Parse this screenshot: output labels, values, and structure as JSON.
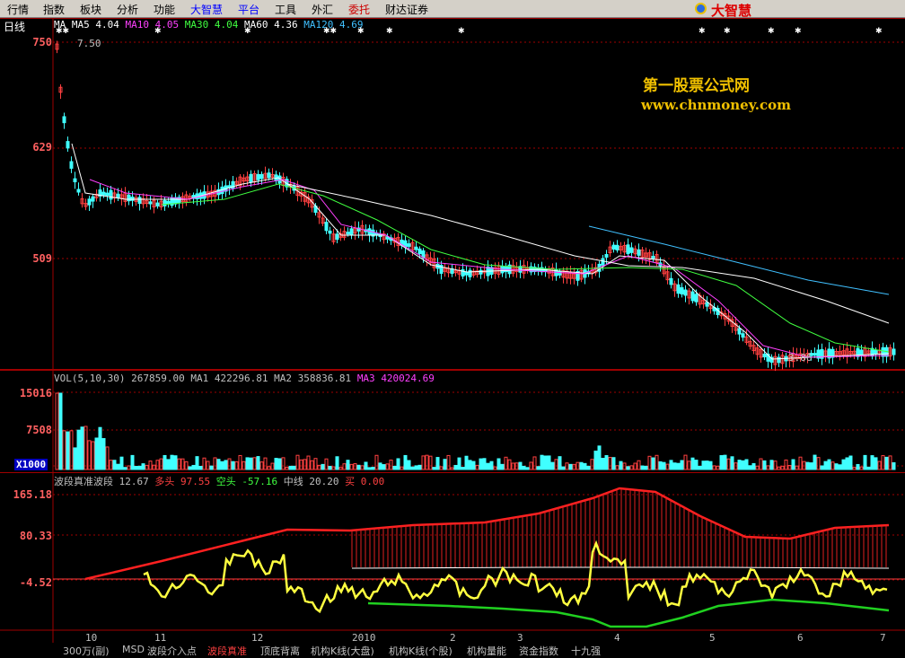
{
  "menu": {
    "items": [
      {
        "label": "行情",
        "style": "normal"
      },
      {
        "label": "指数",
        "style": "normal"
      },
      {
        "label": "板块",
        "style": "normal"
      },
      {
        "label": "分析",
        "style": "normal"
      },
      {
        "label": "功能",
        "style": "normal"
      },
      {
        "label": "大智慧",
        "style": "brand"
      },
      {
        "label": "平台",
        "style": "brand"
      },
      {
        "label": "工具",
        "style": "normal"
      },
      {
        "label": "外汇",
        "style": "normal"
      },
      {
        "label": "委托",
        "style": "red"
      },
      {
        "label": "财达证券",
        "style": "normal"
      }
    ],
    "logo": "大智慧",
    "logo_icon": "globe-icon"
  },
  "main_chart": {
    "period": "日线",
    "legend": [
      {
        "label": "MA",
        "value": "",
        "color": "#ffffff"
      },
      {
        "label": "MA5",
        "value": "4.04",
        "color": "#ffffff"
      },
      {
        "label": "MA10",
        "value": "4.05",
        "color": "#ff40ff"
      },
      {
        "label": "MA30",
        "value": "4.04",
        "color": "#40ff40"
      },
      {
        "label": "MA60",
        "value": "4.36",
        "color": "#ffffff"
      },
      {
        "label": "MA120",
        "value": "4.69",
        "color": "#40c0ff"
      }
    ],
    "high_marker": "7.50",
    "low_marker": "3.86",
    "y_labels": [
      "750",
      "629",
      "509"
    ],
    "watermark_title": "第一股票公式网",
    "watermark_url": "www.chnmoney.com"
  },
  "volume_chart": {
    "legend": [
      {
        "label": "VOL(5,10,30)",
        "value": "267859.00",
        "color": "#c0c0c0"
      },
      {
        "label": "MA1",
        "value": "422296.81",
        "color": "#c0c0c0"
      },
      {
        "label": "MA2",
        "value": "358836.81",
        "color": "#c0c0c0"
      },
      {
        "label": "MA3",
        "value": "420024.69",
        "color": "#ff40ff"
      }
    ],
    "y_labels": [
      "15016",
      "7508"
    ],
    "unit": "X1000"
  },
  "indicator_chart": {
    "legend": [
      {
        "label": "波段真准波段",
        "value": "12.67",
        "color": "#c0c0c0"
      },
      {
        "label": "多头",
        "value": "97.55",
        "color": "#ff4040"
      },
      {
        "label": "空头",
        "value": "-57.16",
        "color": "#40ff40"
      },
      {
        "label": "中线",
        "value": "20.20",
        "color": "#c0c0c0"
      },
      {
        "label": "买",
        "value": "0.00",
        "color": "#ff4040"
      }
    ],
    "y_labels": [
      "165.18",
      "80.33",
      "-4.52"
    ]
  },
  "x_axis": {
    "labels": [
      "10",
      "11",
      "12",
      "2010",
      "2",
      "3",
      "4",
      "5",
      "6",
      "7"
    ]
  },
  "bottom_tabs": [
    {
      "label": "300万(副)",
      "active": false
    },
    {
      "label": "MSD",
      "active": false
    },
    {
      "label": "波段介入点",
      "active": false
    },
    {
      "label": "波段真准",
      "active": true
    },
    {
      "label": "顶底背离",
      "active": false
    },
    {
      "label": "机构K线(大盘)",
      "active": false
    },
    {
      "label": "机构K线(个股)",
      "active": false
    },
    {
      "label": "机构量能",
      "active": false
    },
    {
      "label": "资金指数",
      "active": false
    },
    {
      "label": "十九强",
      "active": false
    }
  ],
  "colors": {
    "background": "#000000",
    "grid": "#a00000",
    "up": "#ff4040",
    "down": "#40ffff",
    "ma5": "#ffffff",
    "ma10": "#ff40ff",
    "ma30": "#40ff40",
    "ma120": "#40c0ff",
    "wave": "#ffff40",
    "bull": "#ff2020",
    "bear": "#20d020"
  }
}
